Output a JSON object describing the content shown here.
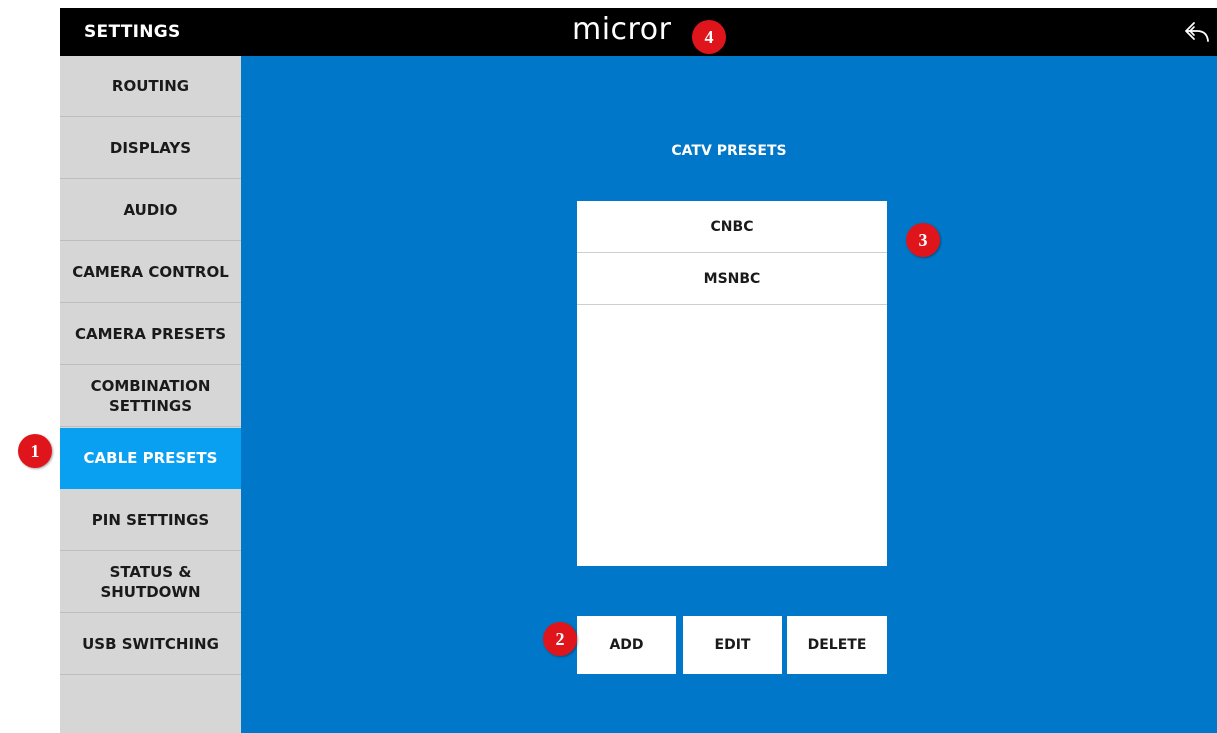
{
  "header": {
    "title": "SETTINGS",
    "logo_text": "micror",
    "back_icon": "back-arrow-icon"
  },
  "sidebar": {
    "items": [
      {
        "label": "ROUTING",
        "active": false
      },
      {
        "label": "DISPLAYS",
        "active": false
      },
      {
        "label": "AUDIO",
        "active": false
      },
      {
        "label": "CAMERA CONTROL",
        "active": false
      },
      {
        "label": "CAMERA PRESETS",
        "active": false
      },
      {
        "label": "COMBINATION\nSETTINGS",
        "active": false
      },
      {
        "label": "CABLE PRESETS",
        "active": true
      },
      {
        "label": "PIN SETTINGS",
        "active": false
      },
      {
        "label": "STATUS &\nSHUTDOWN",
        "active": false
      },
      {
        "label": "USB SWITCHING",
        "active": false
      }
    ]
  },
  "main": {
    "section_title": "CATV PRESETS",
    "presets": [
      "CNBC",
      "MSNBC"
    ],
    "buttons": {
      "add": "ADD",
      "edit": "EDIT",
      "delete": "DELETE"
    }
  },
  "annotations": [
    "1",
    "2",
    "3",
    "4"
  ],
  "colors": {
    "background": "#0077c8",
    "topbar": "#000000",
    "sidebar": "#d6d6d6",
    "active_item": "#0aa0f2",
    "badge": "#e0151c"
  }
}
